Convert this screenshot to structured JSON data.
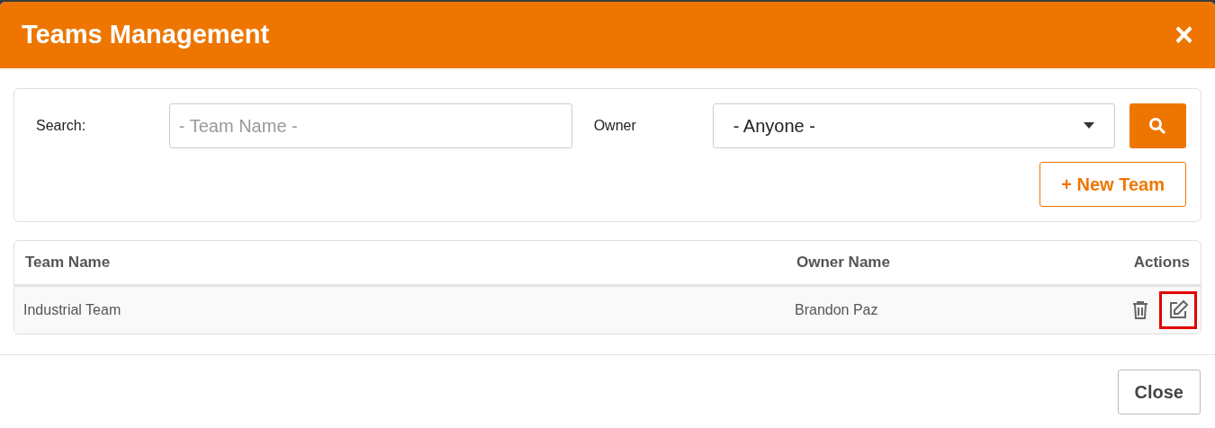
{
  "dialog": {
    "title": "Teams Management",
    "close_icon": "×"
  },
  "filters": {
    "search_label": "Search:",
    "search_placeholder": "- Team Name -",
    "owner_label": "Owner",
    "owner_value": "- Anyone -",
    "new_button": "+ New Team"
  },
  "table": {
    "columns": [
      "Team Name",
      "Owner Name",
      "Actions"
    ],
    "rows": [
      {
        "team_name": "Industrial Team",
        "owner_name": "Brandon Paz",
        "actions": [
          {
            "kind": "delete",
            "highlighted": false
          },
          {
            "kind": "edit",
            "highlighted": true
          }
        ]
      }
    ]
  },
  "footer": {
    "close_button": "Close"
  }
}
